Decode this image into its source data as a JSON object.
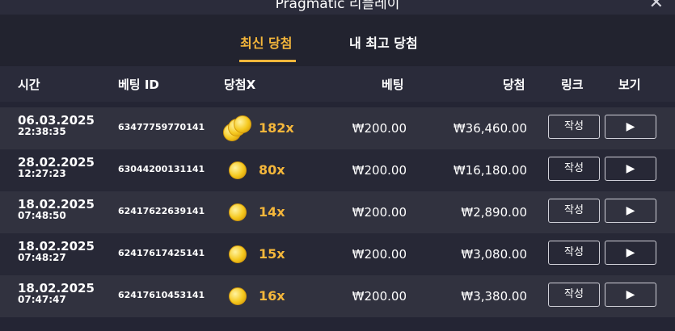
{
  "window": {
    "title": "Pragmatic 리플레이",
    "close_glyph": "✕"
  },
  "tabs": [
    {
      "label": "최신 당첨",
      "active": true
    },
    {
      "label": "내 최고 당첨",
      "active": false
    }
  ],
  "columns": {
    "time": "시간",
    "bet_id": "베팅 ID",
    "multiplier": "당첨X",
    "bet": "베팅",
    "win": "당첨",
    "link": "링크",
    "view": "보기"
  },
  "rows": [
    {
      "date": "06.03.2025",
      "time": "22:38:35",
      "bet_id": "63477759770141",
      "multiplier": "182x",
      "icon": "coin-stack-icon",
      "bet": "₩200.00",
      "win": "₩36,460.00",
      "link_label": "작성",
      "view_glyph": "▶"
    },
    {
      "date": "28.02.2025",
      "time": "12:27:23",
      "bet_id": "63044200131141",
      "multiplier": "80x",
      "icon": "coin-icon",
      "bet": "₩200.00",
      "win": "₩16,180.00",
      "link_label": "작성",
      "view_glyph": "▶"
    },
    {
      "date": "18.02.2025",
      "time": "07:48:50",
      "bet_id": "62417622639141",
      "multiplier": "14x",
      "icon": "coin-icon",
      "bet": "₩200.00",
      "win": "₩2,890.00",
      "link_label": "작성",
      "view_glyph": "▶"
    },
    {
      "date": "18.02.2025",
      "time": "07:48:27",
      "bet_id": "62417617425141",
      "multiplier": "15x",
      "icon": "coin-icon",
      "bet": "₩200.00",
      "win": "₩3,080.00",
      "link_label": "작성",
      "view_glyph": "▶"
    },
    {
      "date": "18.02.2025",
      "time": "07:47:47",
      "bet_id": "62417610453141",
      "multiplier": "16x",
      "icon": "coin-icon",
      "bet": "₩200.00",
      "win": "₩3,380.00",
      "link_label": "작성",
      "view_glyph": "▶"
    }
  ],
  "colors": {
    "background": "#242534",
    "accent": "#f5b73b",
    "row_odd": "#31323f",
    "row_even": "#272836"
  }
}
